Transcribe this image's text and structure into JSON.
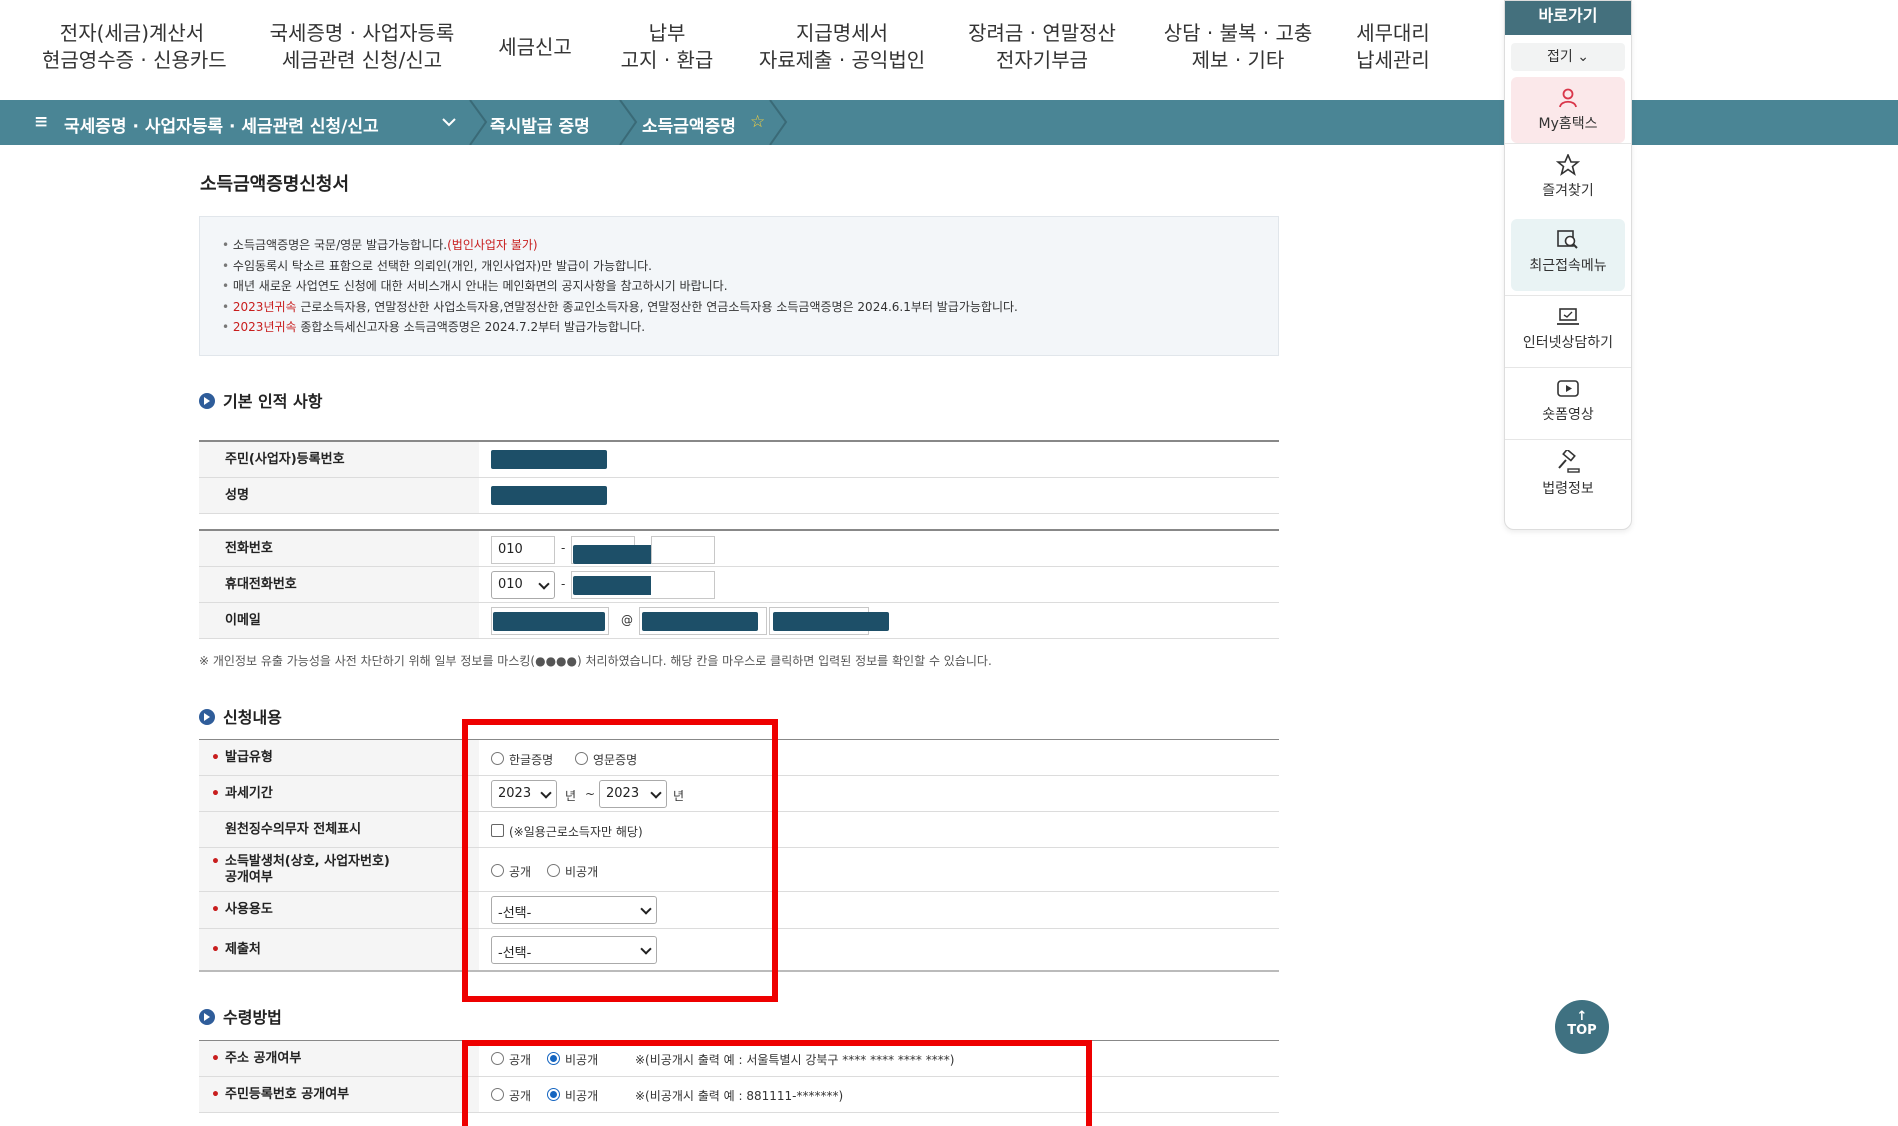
{
  "nav": {
    "menus": [
      {
        "line1": "전자(세금)계산서",
        "line2": "현금영수증 · 신용카드"
      },
      {
        "line1": "국세증명 · 사업자등록",
        "line2": "세금관련 신청/신고"
      },
      {
        "line1": "세금신고",
        "line2": ""
      },
      {
        "line1": "납부",
        "line2": "고지 · 환급"
      },
      {
        "line1": "지급명세서",
        "line2": "자료제출 · 공익법인"
      },
      {
        "line1": "장려금 · 연말정산",
        "line2": "전자기부금"
      },
      {
        "line1": "상담 · 불복 · 고충",
        "line2": "제보 · 기타"
      },
      {
        "line1": "세무대리",
        "line2": "납세관리"
      }
    ]
  },
  "breadcrumb": {
    "menu_icon": "≡",
    "level1": "국세증명 · 사업자등록 · 세금관련 신청/신고",
    "level2": "즉시발급 증명",
    "level3": "소득금액증명",
    "star": "☆"
  },
  "quick": {
    "title": "바로가기",
    "fold": "접기",
    "items": [
      {
        "label": "My홈택스",
        "icon": "person-icon"
      },
      {
        "label": "즐겨찾기",
        "icon": "star-icon"
      },
      {
        "label": "최근접속메뉴",
        "icon": "recent-search-icon"
      },
      {
        "label": "인터넷상담하기",
        "icon": "laptop-icon"
      },
      {
        "label": "숏폼영상",
        "icon": "play-icon"
      },
      {
        "label": "법령정보",
        "icon": "gavel-icon"
      }
    ]
  },
  "page": {
    "title": "소득금액증명신청서",
    "notices": [
      {
        "text": "소득금액증명은 국문/영문 발급가능합니다.",
        "red": "(법인사업자 불가)",
        "text2": ""
      },
      {
        "text": "수임동록시 탁소르 표함으로 선택한 의뢰인(개인, 개인사업자)만 발급이 가능합니다.",
        "red": "",
        "text2": ""
      },
      {
        "text": "매년 새로운 사업연도 신청에 대한 서비스개시 안내는 메인화면의 공지사항을 참고하시기 바랍니다.",
        "red": "",
        "text2": ""
      },
      {
        "text": "",
        "red": "2023년귀속",
        "text2": " 근로소득자용, 연말정산한 사업소득자용,연말정산한 종교인소득자용, 연말정산한 연금소득자용 소득금액증명은 2024.6.1부터 발급가능합니다."
      },
      {
        "text": "",
        "red": "2023년귀속",
        "text2": " 종합소득세신고자용 소득금액증명은 2024.7.2부터 발급가능합니다."
      }
    ]
  },
  "basic": {
    "section": "기본 인적 사항",
    "ssn_label": "주민(사업자)등록번호",
    "name_label": "성명",
    "phone_label": "전화번호",
    "phone_prefix": "010",
    "mobile_label": "휴대전화번호",
    "mobile_prefix": "010",
    "email_label": "이메일",
    "at": "@",
    "dash": "-",
    "note": "※ 개인정보 유출 가능성을 사전 차단하기 위해 일부 정보를 마스킹(●●●●) 처리하였습니다. 해당 칸을 마우스로 클릭하면 입력된 정보를 확인할 수 있습니다."
  },
  "apply": {
    "section": "신청내용",
    "issue_type_label": "발급유형",
    "issue_options": [
      "한글증명",
      "영문증명"
    ],
    "period_label": "과세기간",
    "year_from": "2023",
    "year_to": "2023",
    "year_unit": "년",
    "tilde": "~",
    "withholding_label": "원천징수의무자 전체표시",
    "withholding_note": "(※일용근로소득자만 해당)",
    "disclose_label1": "소득발생처(상호, 사업자번호)",
    "disclose_label2": "공개여부",
    "disclose_options": [
      "공개",
      "비공개"
    ],
    "purpose_label": "사용용도",
    "purpose_value": "-선택-",
    "submit_label": "제출처",
    "submit_value": "-선택-"
  },
  "receive": {
    "section": "수령방법",
    "addr_label": "주소 공개여부",
    "addr_options": [
      "공개",
      "비공개"
    ],
    "addr_note": "※(비공개시 출력 예 : 서울특별시 강북구 **** **** **** ****)",
    "rrn_label": "주민등록번호 공개여부",
    "rrn_options": [
      "공개",
      "비공개"
    ],
    "rrn_note": "※(비공개시 출력 예 : 881111-*******)"
  },
  "top_button": {
    "arrow": "↑",
    "label": "TOP"
  }
}
